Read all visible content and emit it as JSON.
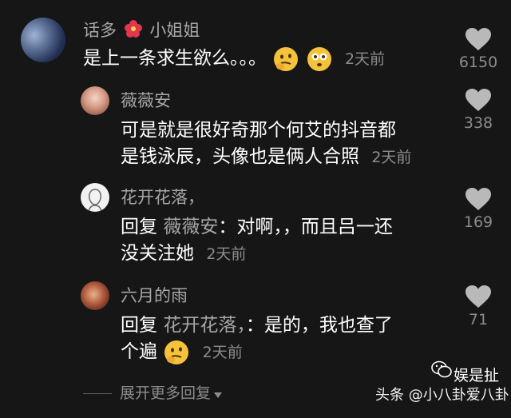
{
  "comments": [
    {
      "username": "话多",
      "username_suffix": "小姐姐",
      "username_icon": "hibiscus-flower-icon",
      "text": "是上一条求生欲么。。。",
      "emojis": [
        "thinking-face-emoji",
        "flushed-face-emoji"
      ],
      "time": "2天前",
      "likes": "6150"
    }
  ],
  "replies": [
    {
      "username": "薇薇安",
      "text_line1": "可是就是很好奇那个何艾的抖音都",
      "text_line2": "是钱泳辰，头像也是俩人合照",
      "time": "2天前",
      "likes": "338"
    },
    {
      "username": "花开花落，",
      "reply_prefix": "回复",
      "reply_to": "薇薇安",
      "text_line1": "：对啊，，而且吕一还",
      "text_line2": "没关注她",
      "time": "2天前",
      "likes": "169"
    },
    {
      "username": "六月的雨",
      "reply_prefix": "回复",
      "reply_to": "花开花落，",
      "text_line1": "：是的，我也查了",
      "text_line2": "个遍",
      "emojis": [
        "thinking-face-emoji"
      ],
      "time": "2天前",
      "likes": "71"
    }
  ],
  "expand_more_label": "展开更多回复",
  "watermark": {
    "brand": "娱是扯",
    "text": "头条 @小八卦爱八卦"
  },
  "colors": {
    "background": "#161616",
    "primary_text": "#ffffff",
    "secondary_text": "#a7a7a7",
    "meta_text": "#8c8c8c",
    "heart_icon": "#b9b9b9",
    "emoji": "#f5c33b"
  }
}
